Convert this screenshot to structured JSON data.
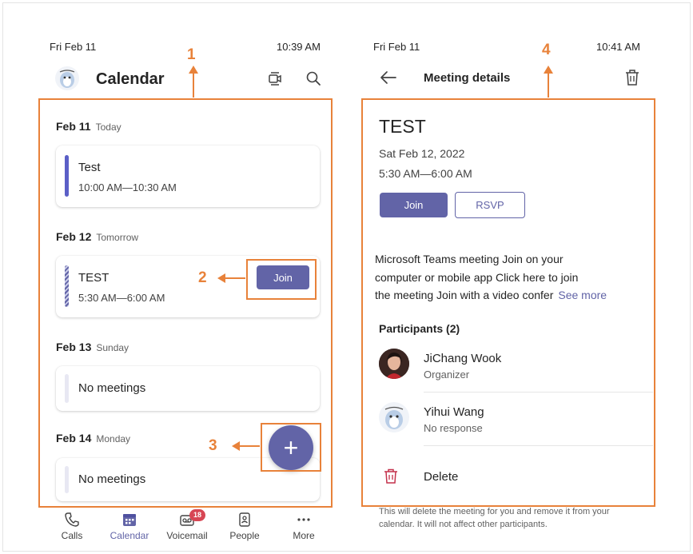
{
  "left": {
    "status_date": "Fri Feb 11",
    "status_time": "10:39 AM",
    "title": "Calendar",
    "days": [
      {
        "date": "Feb 11",
        "sub": "Today",
        "event_title": "Test",
        "event_time": "10:00 AM—10:30 AM"
      },
      {
        "date": "Feb 12",
        "sub": "Tomorrow",
        "event_title": "TEST",
        "event_time": "5:30 AM—6:00 AM",
        "join_label": "Join"
      },
      {
        "date": "Feb 13",
        "sub": "Sunday",
        "empty_label": "No meetings"
      },
      {
        "date": "Feb 14",
        "sub": "Monday",
        "empty_label": "No meetings"
      }
    ],
    "fab_symbol": "+",
    "nav": [
      {
        "label": "Calls",
        "icon": "phone-icon"
      },
      {
        "label": "Calendar",
        "icon": "calendar-icon"
      },
      {
        "label": "Voicemail",
        "icon": "voicemail-icon",
        "badge": "18"
      },
      {
        "label": "People",
        "icon": "people-icon"
      },
      {
        "label": "More",
        "icon": "more-icon"
      }
    ]
  },
  "right": {
    "status_date": "Fri Feb 11",
    "status_time": "10:41 AM",
    "title": "Meeting details",
    "meeting_title": "TEST",
    "meeting_date": "Sat Feb 12, 2022",
    "meeting_time": "5:30 AM—6:00 AM",
    "join_label": "Join",
    "rsvp_label": "RSVP",
    "description_lines": [
      "Microsoft Teams meeting Join on your",
      "computer or mobile app Click here to join",
      "the meeting Join with a video confer"
    ],
    "see_more": "See more",
    "participants_heading": "Participants (2)",
    "participants": [
      {
        "name": "JiChang Wook",
        "role": "Organizer"
      },
      {
        "name": "Yihui Wang",
        "role": "No response"
      }
    ],
    "delete_label": "Delete",
    "delete_note_lines": [
      "This will delete the meeting for you and remove it from your",
      "calendar. It will not affect other participants."
    ]
  },
  "callouts": [
    "1",
    "2",
    "3",
    "4"
  ],
  "colors": {
    "accent": "#6264a7",
    "annotation": "#e8823a",
    "delete": "#c4314b",
    "badge": "#d74654"
  }
}
